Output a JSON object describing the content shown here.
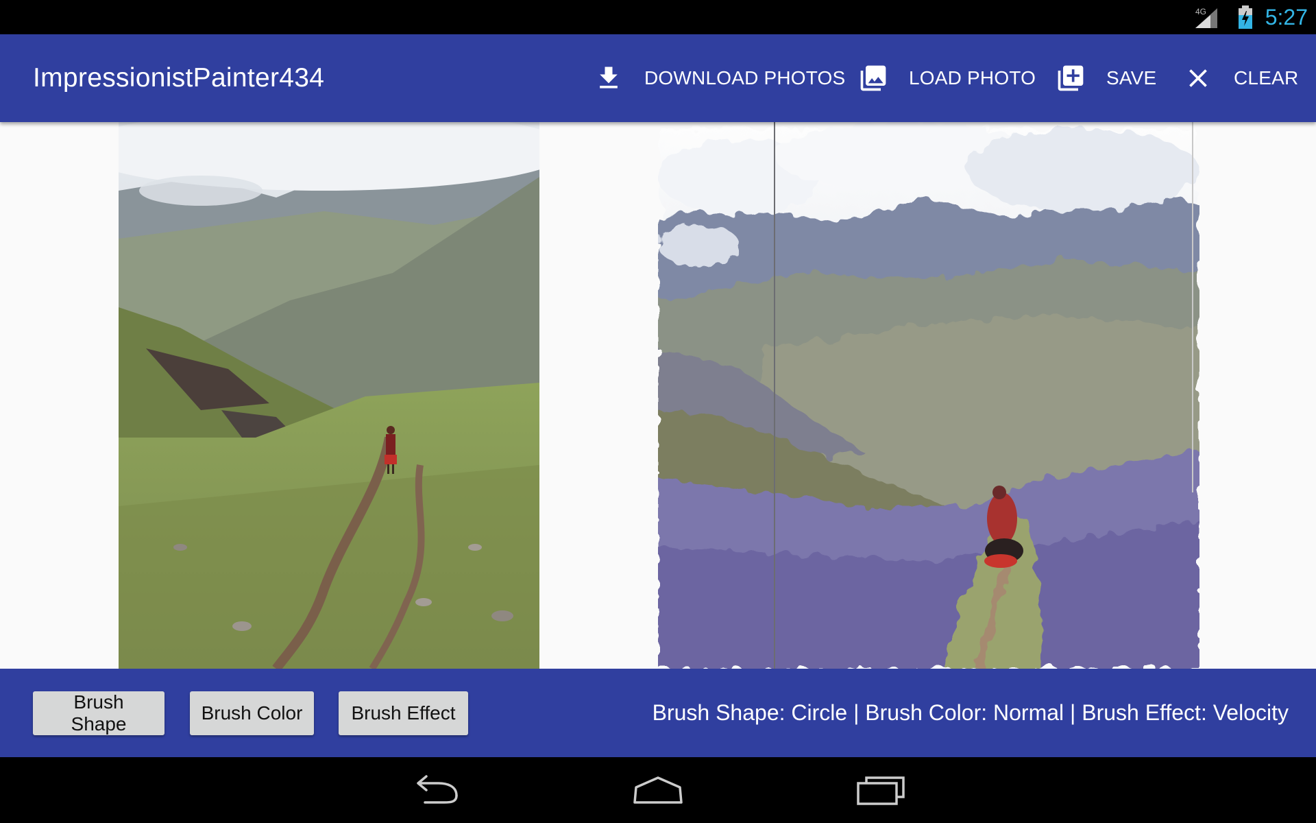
{
  "status_bar": {
    "network_label": "4G",
    "time": "5:27",
    "icons": [
      "signal-icon",
      "battery-charging-icon"
    ]
  },
  "app_bar": {
    "title": "ImpressionistPainter434",
    "actions": [
      {
        "label": "DOWNLOAD PHOTOS",
        "icon": "download-icon"
      },
      {
        "label": "LOAD PHOTO",
        "icon": "photo-library-icon"
      },
      {
        "label": "SAVE",
        "icon": "add-to-photos-icon"
      },
      {
        "label": "CLEAR",
        "icon": "close-icon"
      }
    ]
  },
  "content": {
    "original_image": "mountain-path-photo",
    "painted_canvas": "impressionist-rendering"
  },
  "bottom_bar": {
    "buttons": [
      {
        "label": "Brush Shape"
      },
      {
        "label": "Brush Color"
      },
      {
        "label": "Brush Effect"
      }
    ],
    "summary": "Brush Shape: Circle | Brush Color: Normal | Brush Effect: Velocity"
  },
  "nav_bar": {
    "icons": [
      "back-icon",
      "home-icon",
      "recent-apps-icon"
    ]
  },
  "colors": {
    "primary": "#303f9f",
    "status_clock": "#33b5e5",
    "button_bg": "#d6d7d7"
  }
}
